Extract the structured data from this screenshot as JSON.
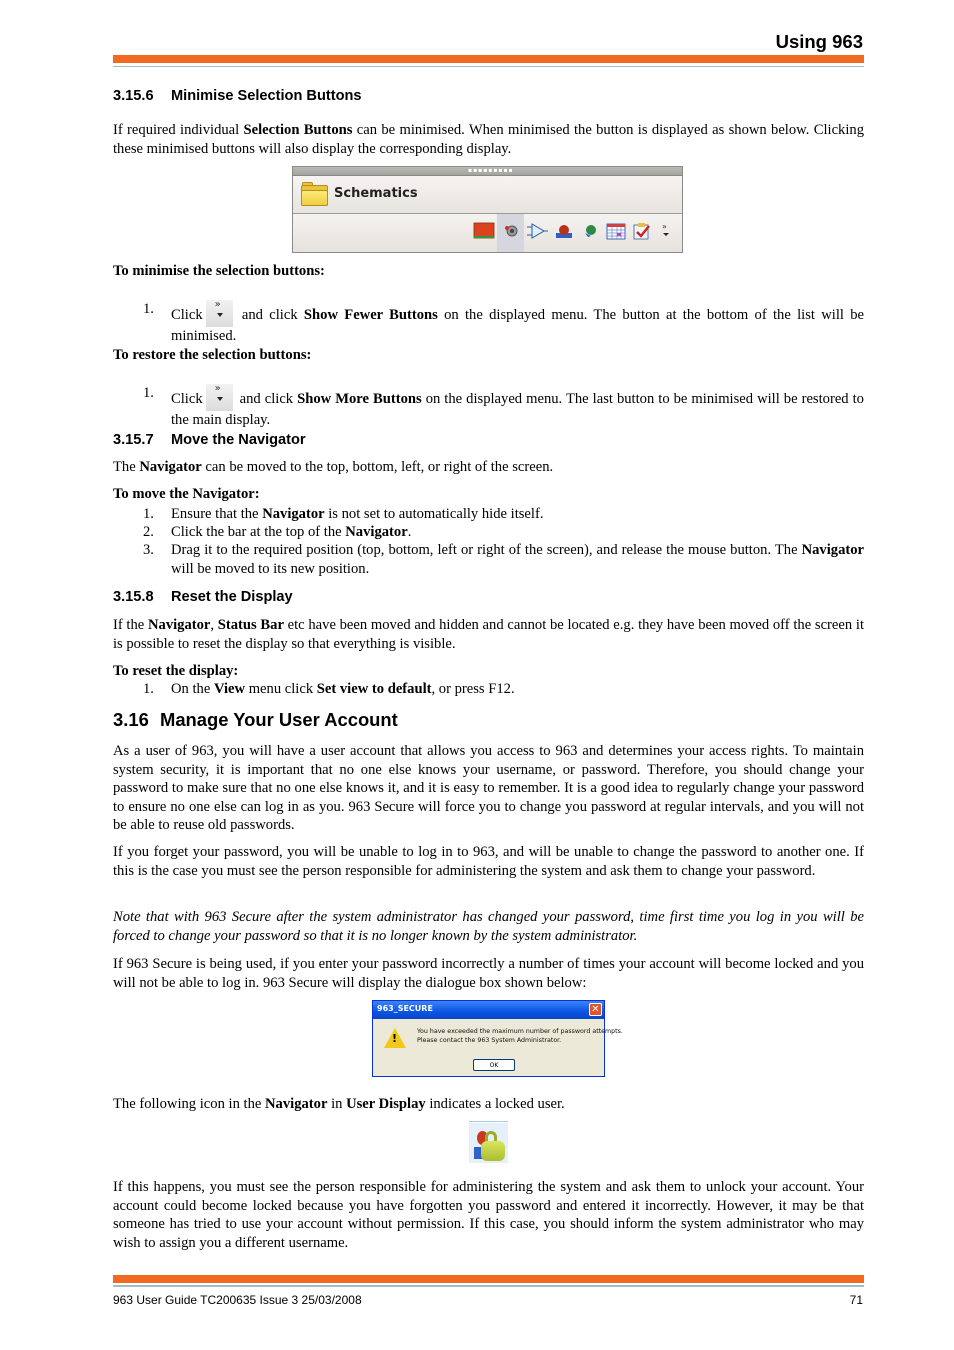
{
  "header": {
    "title": "Using 963"
  },
  "sections": {
    "s3156": {
      "number": "3.15.6",
      "title": "Minimise Selection Buttons",
      "intro": [
        "If required individual ",
        "Selection Buttons",
        " can be minimised. When minimised the button is displayed as shown below. Clicking these minimised buttons will also display the corresponding display."
      ],
      "panel": {
        "title": "Schematics",
        "icons": [
          "alarm-panel-icon",
          "speaker-icon",
          "schematic-logic-icon",
          "operator-icon",
          "network-globe-icon",
          "calendar-icon",
          "checklist-icon",
          "more-buttons-icon"
        ]
      },
      "minimise_heading": "To minimise the selection buttons:",
      "minimise_step": {
        "n": "1.",
        "pre": "Click",
        "mid": " and click ",
        "bold": "Show Fewer Buttons",
        "post": " on the displayed menu. The button at the bottom of the list will be minimised."
      },
      "restore_heading": "To restore the selection buttons:",
      "restore_step": {
        "n": "1.",
        "pre": "Click",
        "mid": " and click ",
        "bold": "Show More Buttons",
        "post": " on the displayed menu. The last button to be minimised will be restored to the main display."
      }
    },
    "s3157": {
      "number": "3.15.7",
      "title": "Move the Navigator",
      "intro": [
        "The ",
        "Navigator",
        " can be moved to the top, bottom, left, or right of the screen."
      ],
      "heading": "To move the Navigator:",
      "steps": [
        {
          "n": "1.",
          "a": "Ensure that the ",
          "b": "Navigator",
          "c": " is not set to automatically hide itself."
        },
        {
          "n": "2.",
          "a": "Click the bar at the top of the ",
          "b": "Navigator",
          "c": "."
        },
        {
          "n": "3.",
          "a": "Drag it to the required position (top, bottom, left or right of the screen), and release the mouse button. The ",
          "b": "Navigator",
          "c": " will be moved to its new position."
        }
      ]
    },
    "s3158": {
      "number": "3.15.8",
      "title": "Reset the Display",
      "intro": [
        "If the ",
        "Navigator",
        ", ",
        "Status Bar",
        " etc have been moved and hidden and cannot be located e.g. they have been moved off the screen it is possible to reset the display so that everything is visible."
      ],
      "heading": "To reset the display:",
      "step": {
        "n": "1.",
        "a": "On the ",
        "b": "View",
        "c": " menu click ",
        "d": "Set view to default",
        "e": ", or press F12."
      }
    },
    "s316": {
      "number": "3.16",
      "title": "Manage Your User Account",
      "p1": "As a user of 963, you will have a user account that allows you access to 963 and determines your access rights. To maintain system security, it is important that no one else knows your username, or password. Therefore, you should change your password to make sure that no one else knows it, and it is easy to remember. It is a good idea to regularly change your password to ensure no one else can log in as you. 963 Secure will force you to change you password at regular intervals, and you will not be able to reuse old passwords.",
      "p2": "If you forget your password, you will be unable to log in to 963, and will be unable to change the password to another one. If this is the case you must see the person responsible for administering the system and ask them to change your password.",
      "note": "Note that with 963 Secure after the system administrator has changed your password, time first time you log in you will be forced to change your password so that it is no longer known by the system administrator.",
      "p3": "If 963 Secure is being used, if you enter your password incorrectly a number of times your account will become locked and you will not be able to log in. 963 Secure will display the dialogue box shown below:",
      "dialog": {
        "title": "963_SECURE",
        "close": "✕",
        "line1": "You have exceeded the maximum number of password attempts.",
        "line2": "Please contact the 963 System Administrator.",
        "ok": "OK"
      },
      "p4": [
        "The following icon in the ",
        "Navigator",
        " in ",
        "User Display",
        " indicates a locked user."
      ],
      "p5": "If this happens, you must see the person responsible for administering the system and ask them to unlock your account. Your account could become locked because you have forgotten you password and entered it incorrectly. However, it may be that someone has tried to use your account without permission. If this case, you should inform the system administrator who may wish to assign you a different username."
    }
  },
  "footer": {
    "text": "963 User Guide TC200635 Issue 3 25/03/2008",
    "page": "71"
  },
  "colors": {
    "accent_orange": "#f26a21",
    "rule_teal": "#9dbfc6"
  }
}
